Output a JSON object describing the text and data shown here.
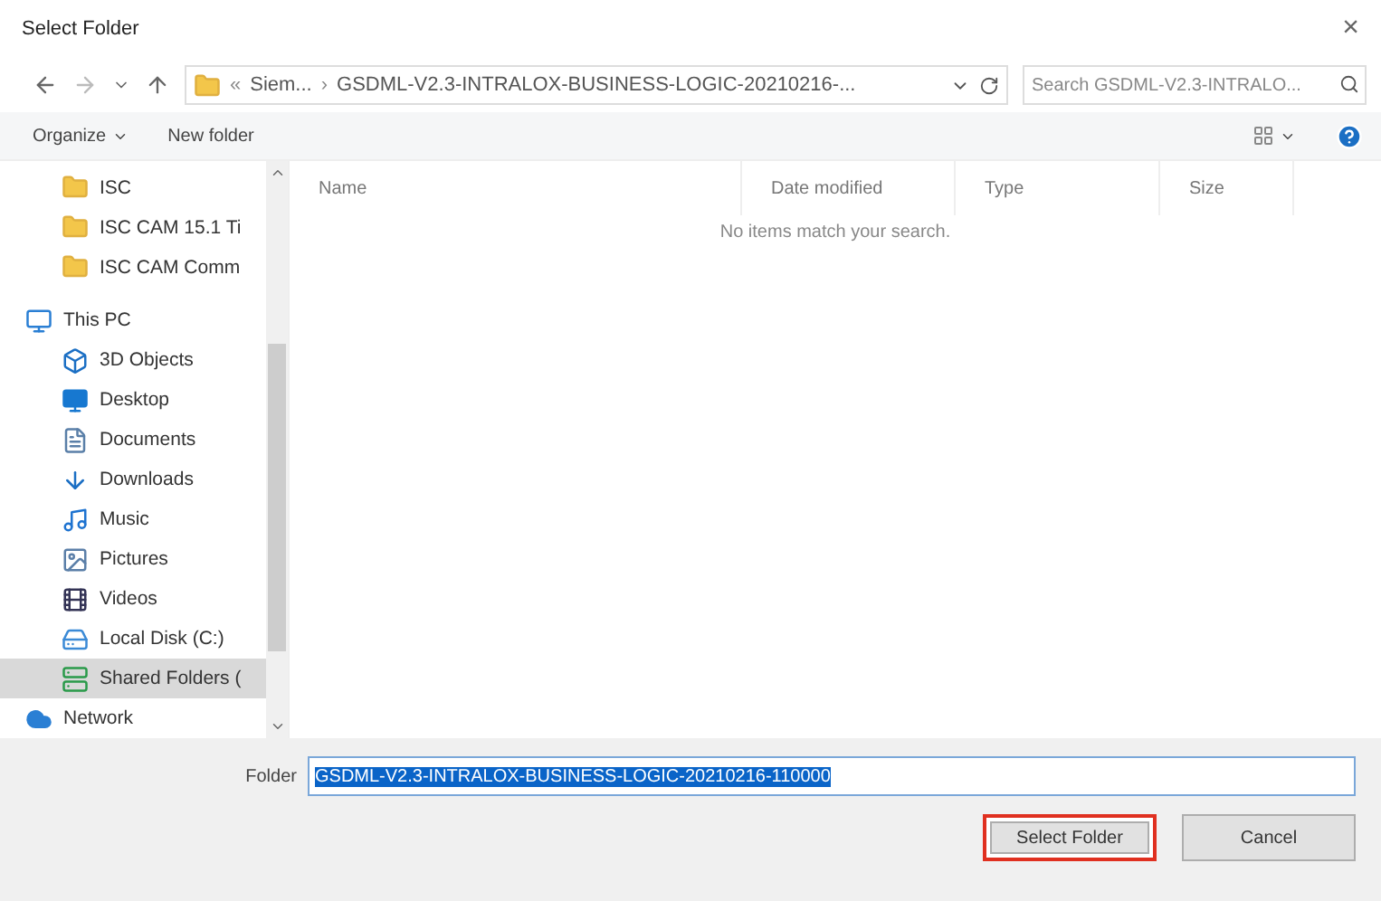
{
  "window": {
    "title": "Select Folder",
    "close": "×"
  },
  "address": {
    "prefix": "«",
    "crumbs": [
      "Siem...",
      "GSDML-V2.3-INTRALOX-BUSINESS-LOGIC-20210216-..."
    ],
    "separator": "›"
  },
  "search": {
    "placeholder": "Search GSDML-V2.3-INTRALO..."
  },
  "toolbar": {
    "organize": "Organize",
    "new_folder": "New folder"
  },
  "sidebar": {
    "quick_access_items": [
      {
        "label": "ISC",
        "kind": "folder",
        "selected": false
      },
      {
        "label": "ISC CAM 15.1 Ti",
        "kind": "folder",
        "selected": false
      },
      {
        "label": "ISC CAM Comm",
        "kind": "folder",
        "selected": false
      }
    ],
    "items": [
      {
        "label": "This PC",
        "kind": "pc",
        "selected": false,
        "children": [
          {
            "label": "3D Objects",
            "kind": "objects",
            "selected": false
          },
          {
            "label": "Desktop",
            "kind": "desktop",
            "selected": false
          },
          {
            "label": "Documents",
            "kind": "documents",
            "selected": false
          },
          {
            "label": "Downloads",
            "kind": "downloads",
            "selected": false
          },
          {
            "label": "Music",
            "kind": "music",
            "selected": false
          },
          {
            "label": "Pictures",
            "kind": "pictures",
            "selected": false
          },
          {
            "label": "Videos",
            "kind": "videos",
            "selected": false
          },
          {
            "label": "Local Disk (C:)",
            "kind": "disk",
            "selected": false
          },
          {
            "label": "Shared Folders (",
            "kind": "share",
            "selected": true
          }
        ]
      },
      {
        "label": "Network",
        "kind": "network",
        "selected": false
      }
    ]
  },
  "table": {
    "columns": [
      "Name",
      "Date modified",
      "Type",
      "Size"
    ],
    "empty_message": "No items match your search."
  },
  "footer": {
    "folder_label": "Folder",
    "folder_value": "GSDML-V2.3-INTRALOX-BUSINESS-LOGIC-20210216-110000",
    "value_selected": true,
    "buttons": [
      {
        "label": "Select Folder",
        "highlighted": true
      },
      {
        "label": "Cancel",
        "highlighted": false
      }
    ]
  }
}
